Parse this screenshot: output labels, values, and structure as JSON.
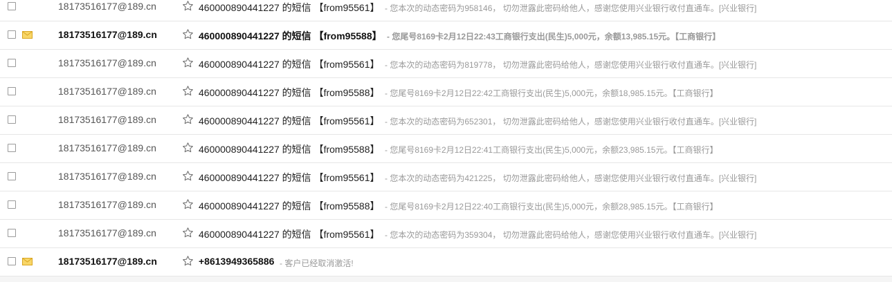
{
  "messages": [
    {
      "sender": "18173516177@189.cn",
      "subject": "460000890441227 的短信 【from95561】",
      "preview": "- 您本次的动态密码为958146， 切勿泄露此密码给他人，感谢您使用兴业银行收付直通车。[兴业银行]",
      "unread": false
    },
    {
      "sender": "18173516177@189.cn",
      "subject": "460000890441227 的短信 【from95588】",
      "preview": "- 您尾号8169卡2月12日22:43工商银行支出(民生)5,000元，余额13,985.15元。【工商银行】",
      "unread": true
    },
    {
      "sender": "18173516177@189.cn",
      "subject": "460000890441227 的短信 【from95561】",
      "preview": "- 您本次的动态密码为819778， 切勿泄露此密码给他人，感谢您使用兴业银行收付直通车。[兴业银行]",
      "unread": false
    },
    {
      "sender": "18173516177@189.cn",
      "subject": "460000890441227 的短信 【from95588】",
      "preview": "- 您尾号8169卡2月12日22:42工商银行支出(民生)5,000元，余额18,985.15元。【工商银行】",
      "unread": false
    },
    {
      "sender": "18173516177@189.cn",
      "subject": "460000890441227 的短信 【from95561】",
      "preview": "- 您本次的动态密码为652301， 切勿泄露此密码给他人，感谢您使用兴业银行收付直通车。[兴业银行]",
      "unread": false
    },
    {
      "sender": "18173516177@189.cn",
      "subject": "460000890441227 的短信 【from95588】",
      "preview": "- 您尾号8169卡2月12日22:41工商银行支出(民生)5,000元，余额23,985.15元。【工商银行】",
      "unread": false
    },
    {
      "sender": "18173516177@189.cn",
      "subject": "460000890441227 的短信 【from95561】",
      "preview": "- 您本次的动态密码为421225， 切勿泄露此密码给他人，感谢您使用兴业银行收付直通车。[兴业银行]",
      "unread": false
    },
    {
      "sender": "18173516177@189.cn",
      "subject": "460000890441227 的短信 【from95588】",
      "preview": "- 您尾号8169卡2月12日22:40工商银行支出(民生)5,000元，余额28,985.15元。【工商银行】",
      "unread": false
    },
    {
      "sender": "18173516177@189.cn",
      "subject": "460000890441227 的短信 【from95561】",
      "preview": "- 您本次的动态密码为359304， 切勿泄露此密码给他人，感谢您使用兴业银行收付直通车。[兴业银行]",
      "unread": false
    },
    {
      "sender": "18173516177@189.cn",
      "subject": "+8613949365886",
      "preview": "- 客户已经取消激活!",
      "unread": true
    }
  ],
  "icons": {
    "unread_marker": "envelope-icon",
    "star": "star-outline-icon",
    "select": "checkbox"
  },
  "colors": {
    "envelope": "#f5c842",
    "divider": "#e6e6e6",
    "preview_text": "#999999"
  }
}
